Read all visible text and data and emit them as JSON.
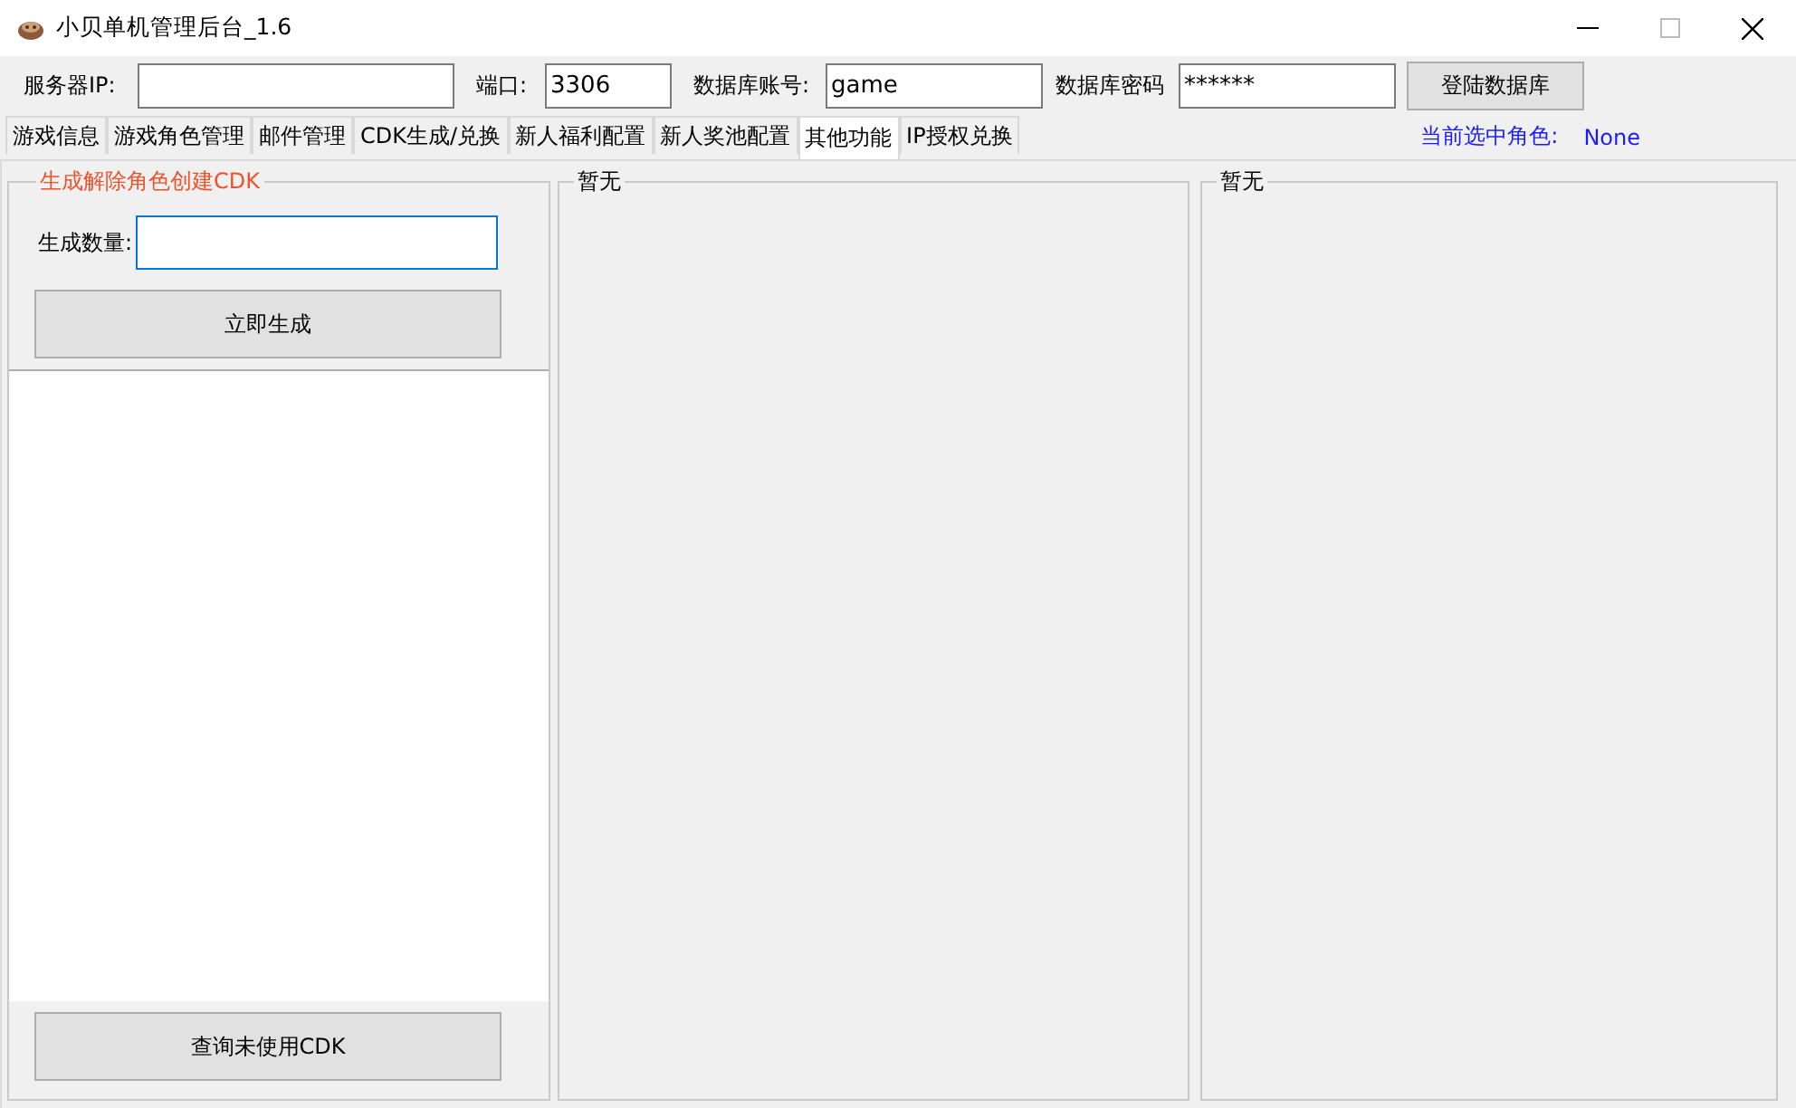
{
  "window": {
    "title": "小贝单机管理后台_1.6"
  },
  "connection": {
    "server_ip_label": "服务器IP:",
    "port_label": "端口:",
    "port": "3306",
    "account_label": "数据库账号:",
    "account": "game",
    "password_label": "数据库密码",
    "password": "******",
    "login_button": "登陆数据库"
  },
  "tabs": [
    {
      "label": "游戏信息",
      "selected": false
    },
    {
      "label": "游戏角色管理",
      "selected": false
    },
    {
      "label": "邮件管理",
      "selected": false
    },
    {
      "label": "CDK生成/兑换",
      "selected": false
    },
    {
      "label": "新人福利配置",
      "selected": false
    },
    {
      "label": "新人奖池配置",
      "selected": false
    },
    {
      "label": "其他功能",
      "selected": true
    },
    {
      "label": "IP授权兑换",
      "selected": false
    }
  ],
  "current_role": {
    "label": "当前选中角色:",
    "value": "None"
  },
  "cdk_group": {
    "title": "生成解除角色创建CDK",
    "count_label": "生成数量:",
    "count_focused": true,
    "generate_button": "立即生成",
    "query_button": "查询未使用CDK"
  },
  "groups": [
    {
      "title": "暂无"
    },
    {
      "title": "暂无"
    }
  ]
}
